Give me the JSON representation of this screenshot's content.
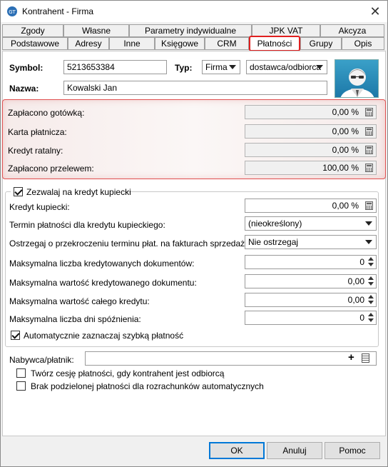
{
  "window": {
    "title": "Kontrahent - Firma"
  },
  "tabs_row1": [
    "Zgody",
    "Własne",
    "Parametry indywidualne",
    "JPK VAT",
    "Akcyza"
  ],
  "tabs_row2": [
    "Podstawowe",
    "Adresy",
    "Inne",
    "Księgowe",
    "CRM",
    "Płatności",
    "Grupy",
    "Opis"
  ],
  "header": {
    "symbol_label": "Symbol:",
    "symbol_value": "5213653384",
    "typ_label": "Typ:",
    "typ_value": "Firma",
    "typ2_value": "dostawca/odbiorca",
    "nazwa_label": "Nazwa:",
    "nazwa_value": "Kowalski Jan"
  },
  "payments": [
    {
      "label": "Zapłacono gotówką:",
      "value": "0,00 %"
    },
    {
      "label": "Karta płatnicza:",
      "value": "0,00 %"
    },
    {
      "label": "Kredyt ratalny:",
      "value": "0,00 %"
    },
    {
      "label": "Zapłacono przelewem:",
      "value": "100,00 %"
    }
  ],
  "credit": {
    "enable_label": "Zezwalaj na kredyt kupiecki",
    "kredyt_label": "Kredyt kupiecki:",
    "kredyt_value": "0,00 %",
    "termin_label": "Termin płatności dla kredytu kupieckiego:",
    "termin_value": "(nieokreślony)",
    "ostrzegaj_label": "Ostrzegaj o przekroczeniu terminu płat. na fakturach sprzedaży:",
    "ostrzegaj_value": "Nie ostrzegaj",
    "max_docs_label": "Maksymalna liczba kredytowanych dokumentów:",
    "max_docs_value": "0",
    "max_doc_val_label": "Maksymalna wartość kredytowanego dokumentu:",
    "max_doc_val_value": "0,00",
    "max_total_label": "Maksymalna wartość całego kredytu:",
    "max_total_value": "0,00",
    "max_days_label": "Maksymalna liczba dni spóźnienia:",
    "max_days_value": "0",
    "auto_label": "Automatycznie zaznaczaj szybką płatność"
  },
  "payer": {
    "label": "Nabywca/płatnik:",
    "value": "",
    "cesja_label": "Twórz cesję płatności, gdy kontrahent jest odbiorcą",
    "split_label": "Brak podzielonej płatności dla rozrachunków automatycznych"
  },
  "buttons": {
    "ok": "OK",
    "cancel": "Anuluj",
    "help": "Pomoc"
  }
}
